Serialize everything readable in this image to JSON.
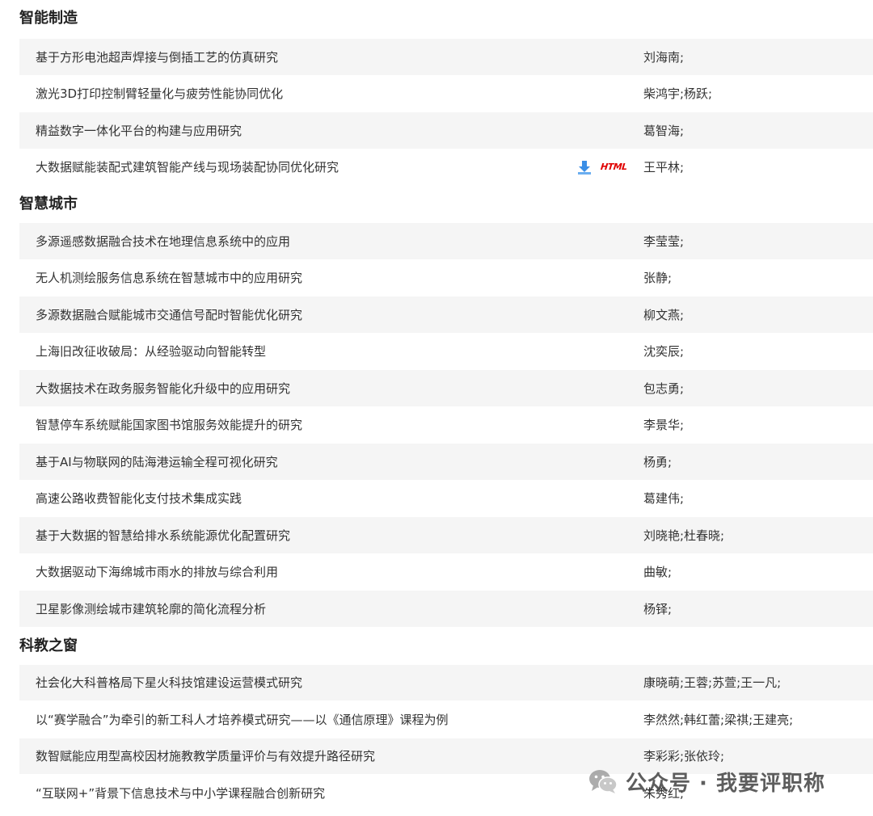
{
  "sections": [
    {
      "title": "智能制造",
      "rows": [
        {
          "title": "基于方形电池超声焊接与倒插工艺的仿真研究",
          "author": "刘海南;"
        },
        {
          "title": "激光3D打印控制臂轻量化与疲劳性能协同优化",
          "author": "柴鸿宇;杨跃;"
        },
        {
          "title": "精益数字一体化平台的构建与应用研究",
          "author": "葛智海;"
        },
        {
          "title": "大数据赋能装配式建筑智能产线与现场装配协同优化研究",
          "author": "王平林;",
          "html_label": "HTML"
        }
      ]
    },
    {
      "title": "智慧城市",
      "rows": [
        {
          "title": "多源遥感数据融合技术在地理信息系统中的应用",
          "author": "李莹莹;"
        },
        {
          "title": "无人机测绘服务信息系统在智慧城市中的应用研究",
          "author": "张静;"
        },
        {
          "title": "多源数据融合赋能城市交通信号配时智能优化研究",
          "author": "柳文燕;"
        },
        {
          "title": "上海旧改征收破局：从经验驱动向智能转型",
          "author": "沈奕辰;"
        },
        {
          "title": "大数据技术在政务服务智能化升级中的应用研究",
          "author": "包志勇;"
        },
        {
          "title": "智慧停车系统赋能国家图书馆服务效能提升的研究",
          "author": "李景华;"
        },
        {
          "title": "基于AI与物联网的陆海港运输全程可视化研究",
          "author": "杨勇;"
        },
        {
          "title": "高速公路收费智能化支付技术集成实践",
          "author": "葛建伟;"
        },
        {
          "title": "基于大数据的智慧给排水系统能源优化配置研究",
          "author": "刘晓艳;杜春晓;"
        },
        {
          "title": "大数据驱动下海绵城市雨水的排放与综合利用",
          "author": "曲敏;"
        },
        {
          "title": "卫星影像测绘城市建筑轮廓的简化流程分析",
          "author": "杨铎;"
        }
      ]
    },
    {
      "title": "科教之窗",
      "rows": [
        {
          "title": "社会化大科普格局下星火科技馆建设运营模式研究",
          "author": "康晓萌;王蓉;苏萱;王一凡;"
        },
        {
          "title": "以“赛学融合”为牵引的新工科人才培养模式研究——以《通信原理》课程为例",
          "author": "李然然;韩红蕾;梁祺;王建亮;"
        },
        {
          "title": "数智赋能应用型高校因材施教教学质量评价与有效提升路径研究",
          "author": "李彩彩;张依玲;"
        },
        {
          "title": "“互联网+”背景下信息技术与中小学课程融合创新研究",
          "author": "朱秀红;"
        }
      ]
    }
  ],
  "watermark": {
    "text": "公众号 · 我要评职称",
    "icon": "wechat-icon"
  },
  "colors": {
    "row_alt_bg": "#f5f5f5",
    "text": "#333333",
    "download_blue": "#3a8ee6",
    "html_red": "#e00000"
  }
}
